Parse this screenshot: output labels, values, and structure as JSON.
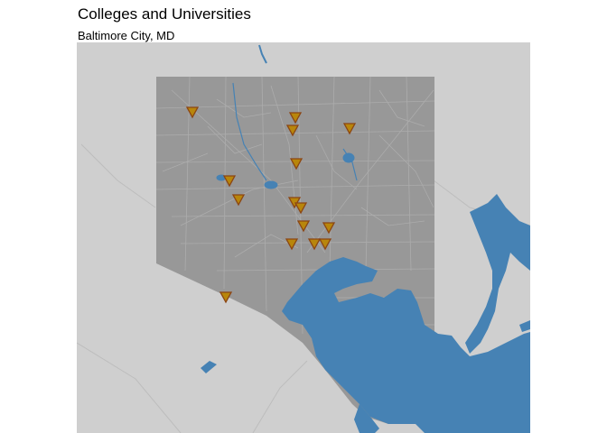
{
  "title": "Colleges and Universities",
  "subtitle": "Baltimore City, MD",
  "colors": {
    "background_land": "#cfcfcf",
    "city_fill": "#989898",
    "streets": "#b3b3b3",
    "water": "#4682b4",
    "marker_fill": "#b8860b",
    "marker_stroke": "#8b4513"
  },
  "marker_icon": "down-triangle-marker",
  "markers": [
    {
      "name": "college-marker-1"
    },
    {
      "name": "college-marker-2"
    },
    {
      "name": "college-marker-3"
    },
    {
      "name": "college-marker-4"
    },
    {
      "name": "college-marker-5"
    },
    {
      "name": "college-marker-6"
    },
    {
      "name": "college-marker-7"
    },
    {
      "name": "college-marker-8"
    },
    {
      "name": "college-marker-9"
    },
    {
      "name": "college-marker-10"
    },
    {
      "name": "college-marker-11"
    },
    {
      "name": "college-marker-12"
    },
    {
      "name": "college-marker-13"
    },
    {
      "name": "college-marker-14"
    },
    {
      "name": "college-marker-15"
    },
    {
      "name": "college-marker-16"
    },
    {
      "name": "college-marker-17"
    }
  ]
}
